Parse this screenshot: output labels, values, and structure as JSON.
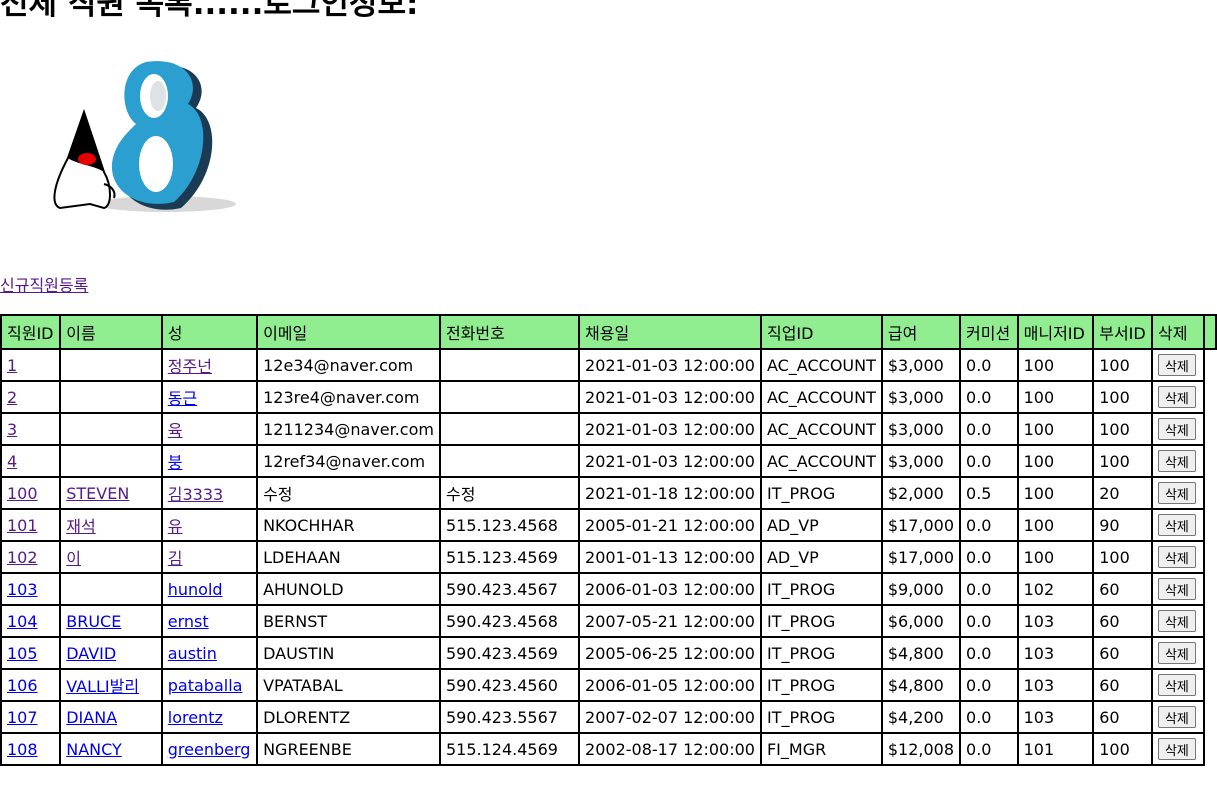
{
  "page": {
    "title": "전체 직원 목록......로그인정보:",
    "register_link": "신규직원등록"
  },
  "table": {
    "headers": [
      "직원ID",
      "이름",
      "성",
      "이메일",
      "전화번호",
      "채용일",
      "직업ID",
      "급여",
      "커미션",
      "매니저ID",
      "부서ID",
      "삭제"
    ],
    "delete_label": "삭제",
    "rows": [
      {
        "id": "1",
        "first": "",
        "last": "정주넌",
        "email": "12e34@naver.com",
        "phone": "",
        "hire": "2021-01-03 12:00:00",
        "job": "AC_ACCOUNT",
        "salary": "$3,000",
        "comm": "0.0",
        "mgr": "100",
        "dept": "100"
      },
      {
        "id": "2",
        "first": "",
        "last": "동근",
        "email": "123re4@naver.com",
        "phone": "",
        "hire": "2021-01-03 12:00:00",
        "job": "AC_ACCOUNT",
        "salary": "$3,000",
        "comm": "0.0",
        "mgr": "100",
        "dept": "100"
      },
      {
        "id": "3",
        "first": "",
        "last": "육",
        "email": "1211234@naver.com",
        "phone": "",
        "hire": "2021-01-03 12:00:00",
        "job": "AC_ACCOUNT",
        "salary": "$3,000",
        "comm": "0.0",
        "mgr": "100",
        "dept": "100"
      },
      {
        "id": "4",
        "first": "",
        "last": "붕",
        "email": "12ref34@naver.com",
        "phone": "",
        "hire": "2021-01-03 12:00:00",
        "job": "AC_ACCOUNT",
        "salary": "$3,000",
        "comm": "0.0",
        "mgr": "100",
        "dept": "100"
      },
      {
        "id": "100",
        "first": "STEVEN",
        "last": "김3333",
        "email": "수정",
        "phone": "수정",
        "hire": "2021-01-18 12:00:00",
        "job": "IT_PROG",
        "salary": "$2,000",
        "comm": "0.5",
        "mgr": "100",
        "dept": "20"
      },
      {
        "id": "101",
        "first": "재석",
        "last": "유",
        "email": "NKOCHHAR",
        "phone": "515.123.4568",
        "hire": "2005-01-21 12:00:00",
        "job": "AD_VP",
        "salary": "$17,000",
        "comm": "0.0",
        "mgr": "100",
        "dept": "90"
      },
      {
        "id": "102",
        "first": "이",
        "last": "김",
        "email": "LDEHAAN",
        "phone": "515.123.4569",
        "hire": "2001-01-13 12:00:00",
        "job": "AD_VP",
        "salary": "$17,000",
        "comm": "0.0",
        "mgr": "100",
        "dept": "100"
      },
      {
        "id": "103",
        "first": "",
        "last": "hunold",
        "email": "AHUNOLD",
        "phone": "590.423.4567",
        "hire": "2006-01-03 12:00:00",
        "job": "IT_PROG",
        "salary": "$9,000",
        "comm": "0.0",
        "mgr": "102",
        "dept": "60"
      },
      {
        "id": "104",
        "first": "BRUCE",
        "last": "ernst",
        "email": "BERNST",
        "phone": "590.423.4568",
        "hire": "2007-05-21 12:00:00",
        "job": "IT_PROG",
        "salary": "$6,000",
        "comm": "0.0",
        "mgr": "103",
        "dept": "60"
      },
      {
        "id": "105",
        "first": "DAVID",
        "last": "austin",
        "email": "DAUSTIN",
        "phone": "590.423.4569",
        "hire": "2005-06-25 12:00:00",
        "job": "IT_PROG",
        "salary": "$4,800",
        "comm": "0.0",
        "mgr": "103",
        "dept": "60"
      },
      {
        "id": "106",
        "first": "VALLI발리",
        "last": "pataballa",
        "email": "VPATABAL",
        "phone": "590.423.4560",
        "hire": "2006-01-05 12:00:00",
        "job": "IT_PROG",
        "salary": "$4,800",
        "comm": "0.0",
        "mgr": "103",
        "dept": "60"
      },
      {
        "id": "107",
        "first": "DIANA",
        "last": "lorentz",
        "email": "DLORENTZ",
        "phone": "590.423.5567",
        "hire": "2007-02-07 12:00:00",
        "job": "IT_PROG",
        "salary": "$4,200",
        "comm": "0.0",
        "mgr": "103",
        "dept": "60"
      },
      {
        "id": "108",
        "first": "NANCY",
        "last": "greenberg",
        "email": "NGREENBE",
        "phone": "515.124.4569",
        "hire": "2002-08-17 12:00:00",
        "job": "FI_MGR",
        "salary": "$12,008",
        "comm": "0.0",
        "mgr": "101",
        "dept": "100"
      }
    ]
  },
  "colors": {
    "header_bg": "#90ee90",
    "visited_link": "#551a8b",
    "link": "#0000ee",
    "logo_blue": "#2a9fd0",
    "logo_dark": "#1b3b55",
    "duke_nose": "#e60000"
  },
  "icons": {
    "logo": "java-8-duke-logo"
  }
}
